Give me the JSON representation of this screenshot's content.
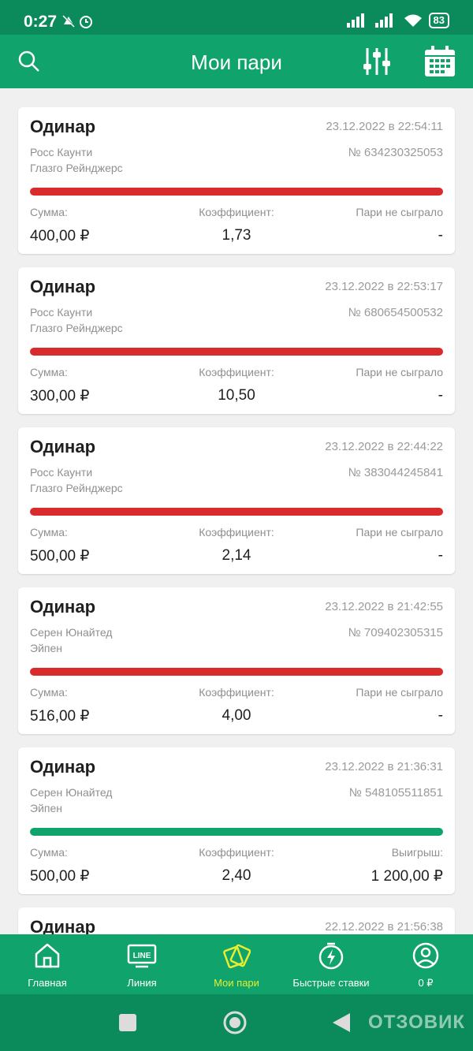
{
  "status": {
    "time": "0:27",
    "battery": "83"
  },
  "header": {
    "title": "Мои пари"
  },
  "labels": {
    "sum": "Сумма:",
    "coef": "Коэффициент:"
  },
  "bets": [
    {
      "type": "Одинар",
      "date": "23.12.2022 в 22:54:11",
      "team1": "Росс Каунти",
      "team2": "Глазго Рейнджерс",
      "number": "№ 634230325053",
      "bar_color": "#d92b2b",
      "result_label": "Пари не сыграло",
      "sum": "400,00 ₽",
      "coef": "1,73",
      "result": "-"
    },
    {
      "type": "Одинар",
      "date": "23.12.2022 в 22:53:17",
      "team1": "Росс Каунти",
      "team2": "Глазго Рейнджерс",
      "number": "№ 680654500532",
      "bar_color": "#d92b2b",
      "result_label": "Пари не сыграло",
      "sum": "300,00 ₽",
      "coef": "10,50",
      "result": "-"
    },
    {
      "type": "Одинар",
      "date": "23.12.2022 в 22:44:22",
      "team1": "Росс Каунти",
      "team2": "Глазго Рейнджерс",
      "number": "№ 383044245841",
      "bar_color": "#d92b2b",
      "result_label": "Пари не сыграло",
      "sum": "500,00 ₽",
      "coef": "2,14",
      "result": "-"
    },
    {
      "type": "Одинар",
      "date": "23.12.2022 в 21:42:55",
      "team1": "Серен Юнайтед",
      "team2": "Эйпен",
      "number": "№ 709402305315",
      "bar_color": "#d92b2b",
      "result_label": "Пари не сыграло",
      "sum": "516,00 ₽",
      "coef": "4,00",
      "result": "-"
    },
    {
      "type": "Одинар",
      "date": "23.12.2022 в 21:36:31",
      "team1": "Серен Юнайтед",
      "team2": "Эйпен",
      "number": "№ 548105511851",
      "bar_color": "#11a36c",
      "result_label": "Выигрыш:",
      "sum": "500,00 ₽",
      "coef": "2,40",
      "result": "1 200,00 ₽"
    },
    {
      "type": "Одинар",
      "date": "22.12.2022 в 21:56:38",
      "team1": "",
      "team2": "",
      "number": "",
      "bar_color": "#d92b2b",
      "result_label": "",
      "sum": "",
      "coef": "",
      "result": ""
    }
  ],
  "nav": [
    {
      "label": "Главная",
      "icon": "home-icon"
    },
    {
      "label": "Линия",
      "icon": "line-icon",
      "badge": "LINE"
    },
    {
      "label": "Мои пари",
      "icon": "tickets-icon",
      "active": true
    },
    {
      "label": "Быстрые ставки",
      "icon": "lightning-timer-icon"
    },
    {
      "label": "0 ₽",
      "icon": "user-icon"
    }
  ],
  "watermark": "ОТЗОВИК",
  "colors": {
    "primary": "#11a36c",
    "dark": "#0b8a5c",
    "lost": "#d92b2b",
    "won": "#11a36c",
    "active_nav": "#e5ee2f"
  }
}
